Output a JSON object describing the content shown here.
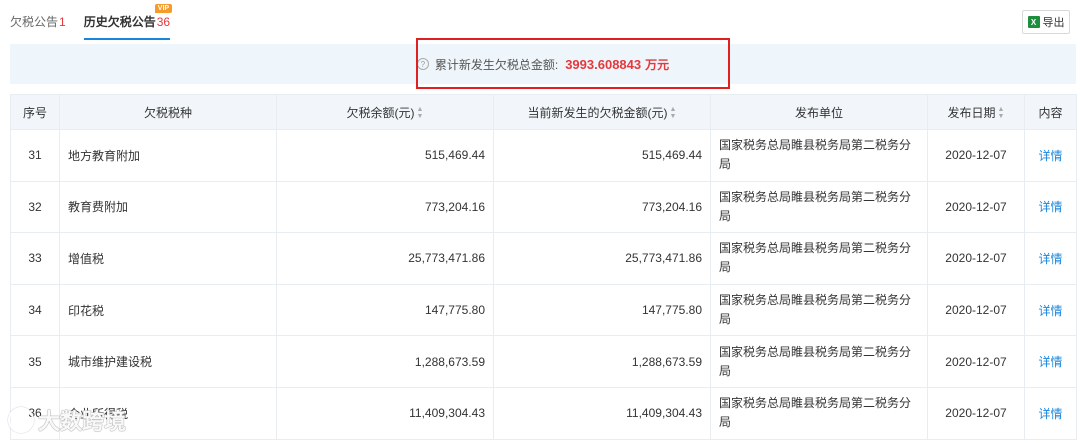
{
  "tabs": [
    {
      "label": "欠税公告",
      "count": "1"
    },
    {
      "label": "历史欠税公告",
      "count": "36",
      "badge": "VIP"
    }
  ],
  "toolbar": {
    "export_label": "导出",
    "export_icon": "excel-icon"
  },
  "summary": {
    "label": "累计新发生欠税总金额:",
    "amount": "3993.608843",
    "unit": "万元",
    "icon": "help-icon"
  },
  "table": {
    "headers": {
      "seq": "序号",
      "tax_type": "欠税税种",
      "balance": "欠税余额(元)",
      "new_amount": "当前新发生的欠税金额(元)",
      "publisher": "发布单位",
      "date": "发布日期",
      "content": "内容"
    },
    "rows": [
      {
        "seq": "31",
        "tax_type": "地方教育附加",
        "balance": "515,469.44",
        "new_amount": "515,469.44",
        "publisher": "国家税务总局睢县税务局第二税务分局",
        "date": "2020-12-07",
        "content": "详情"
      },
      {
        "seq": "32",
        "tax_type": "教育费附加",
        "balance": "773,204.16",
        "new_amount": "773,204.16",
        "publisher": "国家税务总局睢县税务局第二税务分局",
        "date": "2020-12-07",
        "content": "详情"
      },
      {
        "seq": "33",
        "tax_type": "增值税",
        "balance": "25,773,471.86",
        "new_amount": "25,773,471.86",
        "publisher": "国家税务总局睢县税务局第二税务分局",
        "date": "2020-12-07",
        "content": "详情"
      },
      {
        "seq": "34",
        "tax_type": "印花税",
        "balance": "147,775.80",
        "new_amount": "147,775.80",
        "publisher": "国家税务总局睢县税务局第二税务分局",
        "date": "2020-12-07",
        "content": "详情"
      },
      {
        "seq": "35",
        "tax_type": "城市维护建设税",
        "balance": "1,288,673.59",
        "new_amount": "1,288,673.59",
        "publisher": "国家税务总局睢县税务局第二税务分局",
        "date": "2020-12-07",
        "content": "详情"
      },
      {
        "seq": "36",
        "tax_type": "企业所得税",
        "balance": "11,409,304.43",
        "new_amount": "11,409,304.43",
        "publisher": "国家税务总局睢县税务局第二税务分局",
        "date": "2020-12-07",
        "content": "详情"
      }
    ]
  },
  "watermark": {
    "text": "大数跨境"
  },
  "colors": {
    "accent": "#1a86db",
    "amount": "#e4393c",
    "highlight_border": "#e02020",
    "header_bg": "#f2f6fa",
    "summary_bg": "#eef5fb"
  }
}
